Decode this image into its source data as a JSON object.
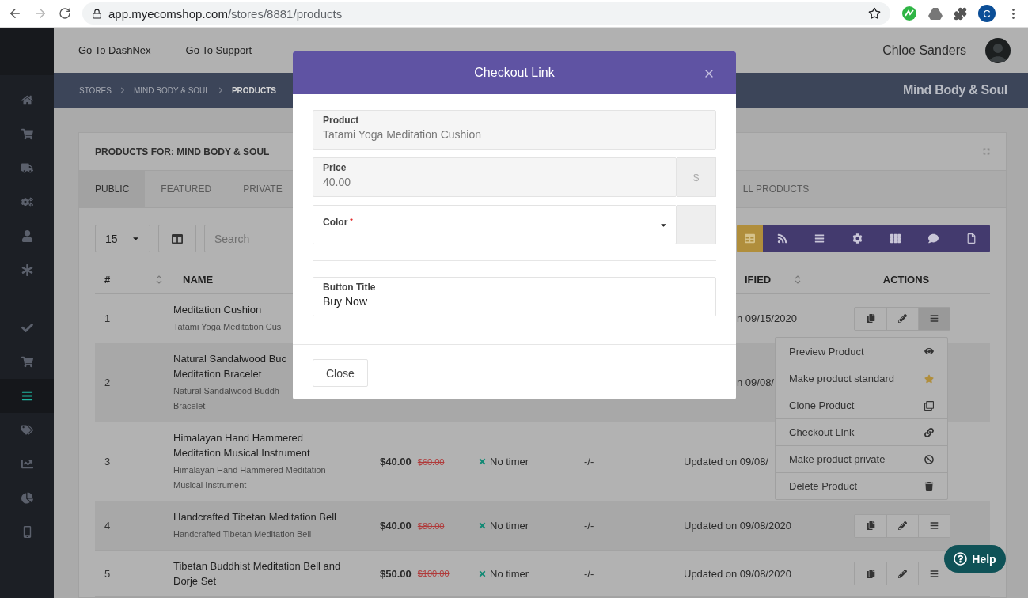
{
  "browser": {
    "url_host": "app.myecomshop.com",
    "url_path": "/stores/8881/products",
    "profile_initial": "C"
  },
  "sidebar": {
    "items": [
      {
        "selected": false
      },
      {
        "selected": false
      },
      {
        "selected": false
      },
      {
        "selected": false
      },
      {
        "selected": false
      },
      {
        "selected": false
      },
      {
        "selected": false
      },
      {
        "selected": false
      },
      {
        "selected": true
      },
      {
        "selected": false
      },
      {
        "selected": false
      },
      {
        "selected": false
      },
      {
        "selected": false
      }
    ]
  },
  "topbar": {
    "links": [
      "Go To DashNex",
      "Go To Support"
    ],
    "user_name": "Chloe Sanders"
  },
  "breadcrumb": {
    "items": [
      {
        "label": "STORES",
        "selected": false
      },
      {
        "label": "MIND BODY & SOUL",
        "selected": false
      },
      {
        "label": "PRODUCTS",
        "selected": true
      }
    ],
    "store_name": "Mind Body & Soul"
  },
  "card": {
    "title": "PRODUCTS FOR: MIND BODY & SOUL",
    "tabs": [
      {
        "label": "PUBLIC",
        "selected": true
      },
      {
        "label": "FEATURED",
        "selected": false
      },
      {
        "label": "PRIVATE",
        "selected": false
      },
      {
        "label": "LL PRODUCTS",
        "selected": false
      }
    ],
    "page_size": "15",
    "search": {
      "placeholder": "Search"
    },
    "view_buttons": [
      {
        "selected": true
      },
      {
        "selected": false
      },
      {
        "selected": false
      },
      {
        "selected": false
      },
      {
        "selected": false
      },
      {
        "selected": false
      },
      {
        "selected": false
      }
    ],
    "table": {
      "columns": [
        {
          "label": "#",
          "sortable": true
        },
        {
          "label": "NAME",
          "sortable": false
        },
        {
          "label": "IFIED",
          "sortable": true
        },
        {
          "label": "ACTIONS",
          "sortable": false
        }
      ],
      "rows": [
        {
          "number": "1",
          "name_lines": [
            "Meditation Cushion"
          ],
          "subtitle_lines": [
            "Tatami Yoga Meditation Cus"
          ],
          "modified": "n 09/15/2020",
          "actions": {
            "menu_open": true
          }
        },
        {
          "number": "2",
          "name_lines": [
            "Natural Sandalwood Buc",
            "Meditation Bracelet"
          ],
          "subtitle_lines": [
            "Natural Sandalwood Buddh",
            "Bracelet"
          ],
          "modified": "n 09/08/"
        },
        {
          "number": "3",
          "name_lines": [
            "Himalayan Hand Hammered",
            "Meditation Musical Instrument"
          ],
          "subtitle_lines": [
            "Himalayan Hand Hammered Meditation",
            "Musical Instrument"
          ],
          "price": "$40.00",
          "old_price": "$60.00",
          "timer": "No timer",
          "column_5": "-/-",
          "modified": "Updated on 09/08/"
        },
        {
          "number": "4",
          "name_lines": [
            "Handcrafted Tibetan Meditation Bell"
          ],
          "subtitle_lines": [
            "Handcrafted Tibetan Meditation Bell"
          ],
          "price": "$40.00",
          "old_price": "$80.00",
          "timer": "No timer",
          "column_5": "-/-",
          "modified": "Updated on 09/08/2020",
          "actions": {
            "menu_open": false
          }
        },
        {
          "number": "5",
          "name_lines": [
            "Tibetan Buddhist Meditation Bell and",
            "Dorje Set"
          ],
          "price": "$50.00",
          "old_price": "$100.00",
          "timer": "No timer",
          "column_5": "-/-",
          "modified": "Updated on 09/08/2020",
          "actions": {
            "menu_open": false
          }
        }
      ]
    },
    "row_menu": {
      "items": [
        "Preview Product",
        "Make product standard",
        "Clone Product",
        "Checkout Link",
        "Make product private",
        "Delete Product"
      ]
    }
  },
  "modal": {
    "title": "Checkout Link",
    "fields": [
      {
        "kind": "readonly",
        "label": "Product",
        "value": "Tatami Yoga Meditation Cushion"
      },
      {
        "kind": "readonly",
        "label": "Price",
        "value": "40.00",
        "addon": "$"
      },
      {
        "kind": "select",
        "label": "Color",
        "required_mark": "*"
      },
      {
        "kind": "input",
        "label": "Button Title",
        "value": "Buy Now"
      }
    ],
    "close_button": "Close"
  },
  "help_button": "Help"
}
